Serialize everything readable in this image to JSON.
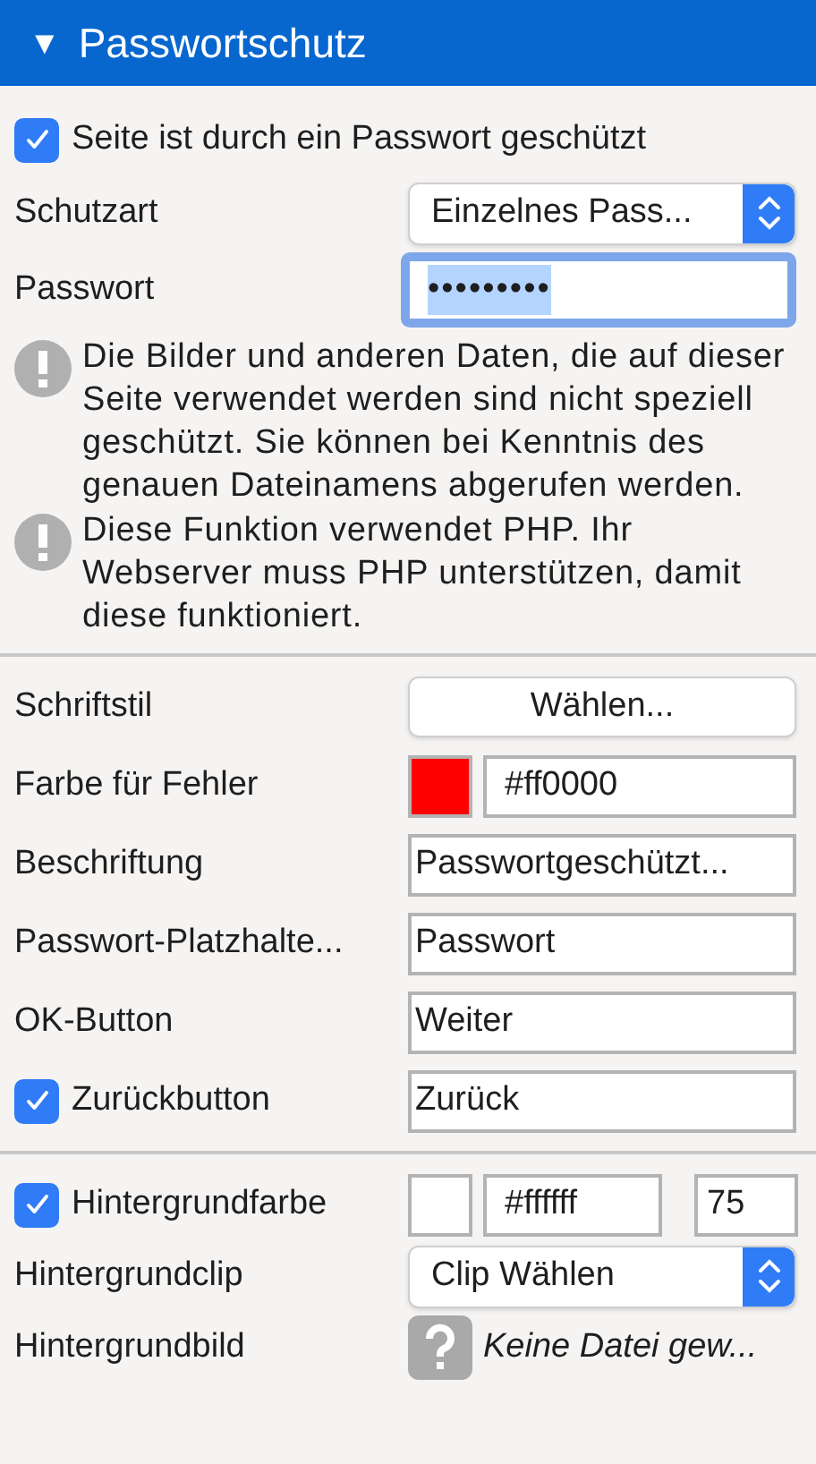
{
  "header": {
    "marker": "▼",
    "title": "Passwortschutz"
  },
  "sections": [
    {
      "rows": [
        {
          "kind": "checkbox",
          "label": "Seite ist durch ein Passwort geschützt",
          "checked": true
        },
        {
          "kind": "select",
          "label": "Schutzart",
          "value": "Einzelnes Pass..."
        },
        {
          "kind": "password",
          "label": "Passwort",
          "value": "•••••••••",
          "focused": true
        },
        {
          "kind": "note",
          "text": "Die Bilder und anderen Daten, die auf dieser Seite verwendet werden sind nicht speziell geschützt. Sie können bei Kenntnis des genauen Dateinamens abgerufen werden."
        },
        {
          "kind": "note",
          "text": "Diese Funktion verwendet PHP. Ihr Webserver muss PHP unterstützen, damit diese funktioniert."
        }
      ]
    },
    {
      "rows": [
        {
          "kind": "button",
          "label": "Schriftstil",
          "value": "Wählen..."
        },
        {
          "kind": "color",
          "label": "Farbe für Fehler",
          "color": "#ff0000",
          "value": "#ff0000"
        },
        {
          "kind": "text",
          "label": "Beschriftung",
          "value": "Passwortgeschützt..."
        },
        {
          "kind": "text",
          "label": "Passwort-Platzhalte...",
          "value": "Passwort"
        },
        {
          "kind": "text",
          "label": "OK-Button",
          "value": "Weiter"
        },
        {
          "kind": "text",
          "label": "Zurückbutton",
          "checked": true,
          "value": "Zurück"
        }
      ]
    },
    {
      "rows": [
        {
          "kind": "color",
          "label": "Hintergrundfarbe",
          "checked": true,
          "color": "#ffffff",
          "value": "#ffffff",
          "extra": "75"
        },
        {
          "kind": "select",
          "label": "Hintergrundclip",
          "value": "Clip Wählen"
        },
        {
          "kind": "file",
          "label": "Hintergrundbild",
          "value": "Keine Datei gew..."
        }
      ]
    }
  ]
}
